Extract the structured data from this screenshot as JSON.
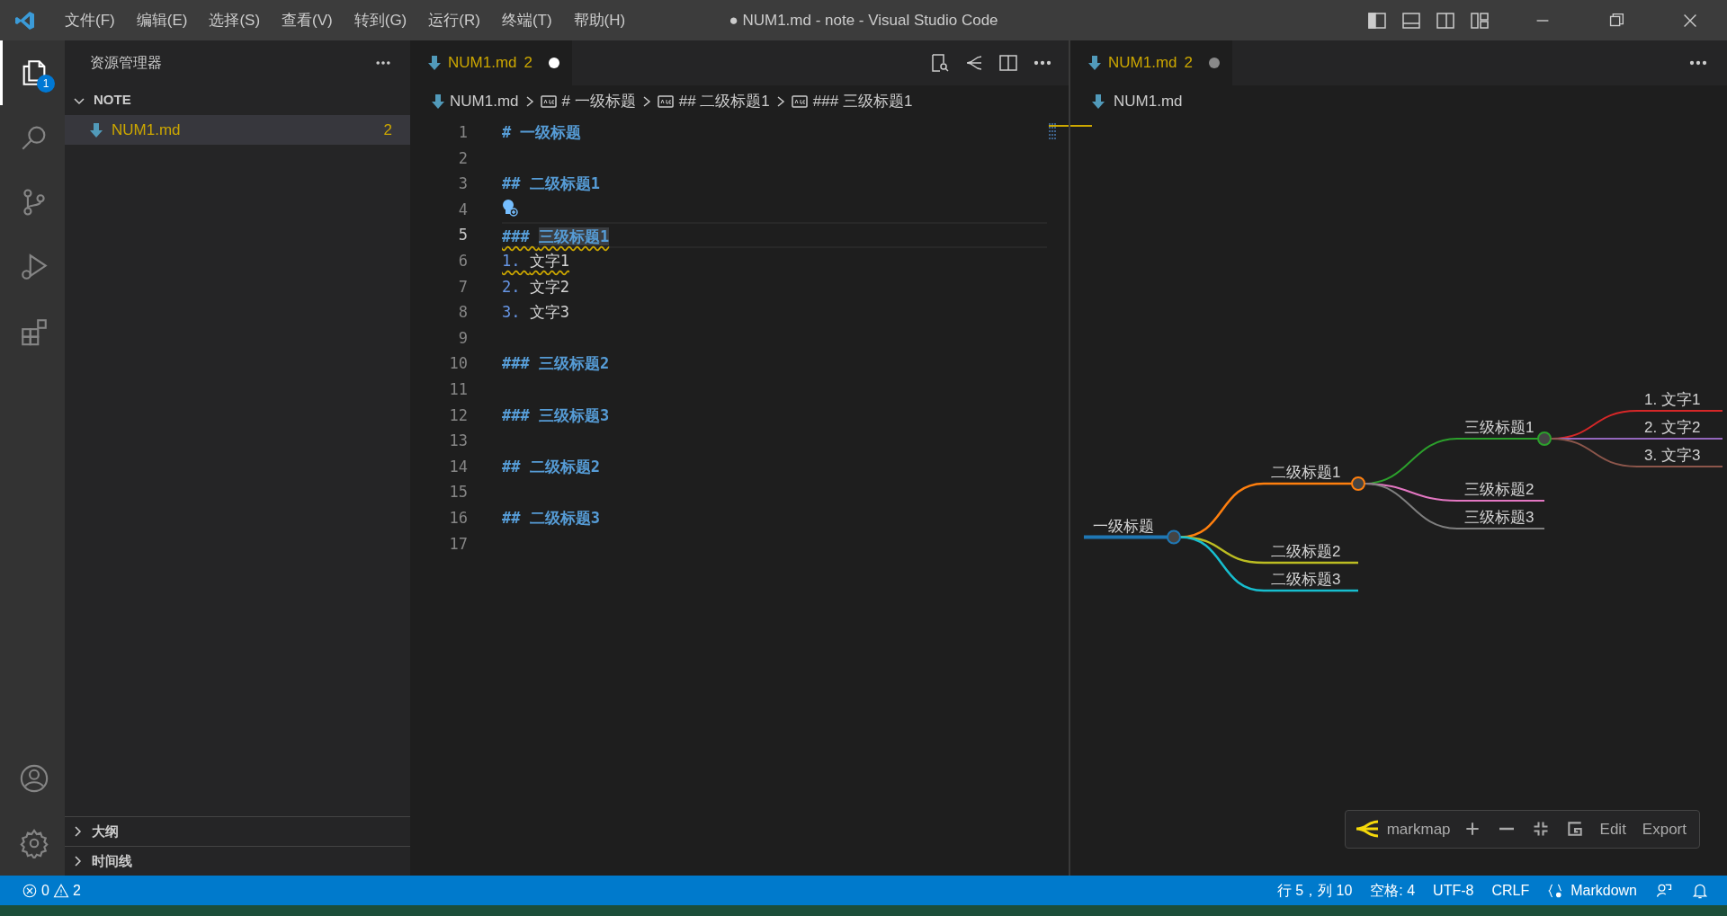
{
  "title_bar": {
    "menus": [
      "文件(F)",
      "编辑(E)",
      "选择(S)",
      "查看(V)",
      "转到(G)",
      "运行(R)",
      "终端(T)",
      "帮助(H)"
    ],
    "title": "● NUM1.md - note - Visual Studio Code"
  },
  "activity_bar": {
    "items": [
      {
        "kind": "explorer",
        "selected": true,
        "badge": "1"
      },
      {
        "kind": "search",
        "selected": false
      },
      {
        "kind": "scm",
        "selected": false
      },
      {
        "kind": "run",
        "selected": false
      },
      {
        "kind": "extensions",
        "selected": false
      }
    ]
  },
  "sidebar": {
    "title": "资源管理器",
    "folder": {
      "label": "NOTE",
      "expanded": true
    },
    "files": [
      {
        "name": "NUM1.md",
        "problems": "2",
        "selected": true
      }
    ],
    "panels": [
      {
        "label": "大纲",
        "expanded": false
      },
      {
        "label": "时间线",
        "expanded": false
      }
    ]
  },
  "editor": {
    "tabs": [
      {
        "label": "NUM1.md",
        "problems": "2",
        "dirty": true,
        "selected": true
      }
    ],
    "breadcrumbs": [
      {
        "kind": "file",
        "label": "NUM1.md"
      },
      {
        "kind": "symbol",
        "label": "# 一级标题"
      },
      {
        "kind": "symbol",
        "label": "## 二级标题1"
      },
      {
        "kind": "symbol",
        "label": "### 三级标题1"
      }
    ],
    "lines": [
      {
        "number": "1",
        "kind": "heading",
        "marker": "#",
        "text": "一级标题",
        "current": false,
        "warning": false
      },
      {
        "number": "2",
        "kind": "blank",
        "current": false
      },
      {
        "number": "3",
        "kind": "heading",
        "marker": "##",
        "text": "二级标题1",
        "current": false,
        "warning": false
      },
      {
        "number": "4",
        "kind": "lightbulb",
        "current": false
      },
      {
        "number": "5",
        "kind": "heading",
        "marker": "###",
        "text": "三级标题1",
        "current": true,
        "warning": true
      },
      {
        "number": "6",
        "kind": "list",
        "marker": "1.",
        "text": "文字1",
        "current": false,
        "warning": true
      },
      {
        "number": "7",
        "kind": "list",
        "marker": "2.",
        "text": "文字2",
        "current": false,
        "warning": false
      },
      {
        "number": "8",
        "kind": "list",
        "marker": "3.",
        "text": "文字3",
        "current": false,
        "warning": false
      },
      {
        "number": "9",
        "kind": "blank",
        "current": false
      },
      {
        "number": "10",
        "kind": "heading",
        "marker": "###",
        "text": "三级标题2",
        "current": false,
        "warning": false
      },
      {
        "number": "11",
        "kind": "blank",
        "current": false
      },
      {
        "number": "12",
        "kind": "heading",
        "marker": "###",
        "text": "三级标题3",
        "current": false,
        "warning": false
      },
      {
        "number": "13",
        "kind": "blank",
        "current": false
      },
      {
        "number": "14",
        "kind": "heading",
        "marker": "##",
        "text": "二级标题2",
        "current": false,
        "warning": false
      },
      {
        "number": "15",
        "kind": "blank",
        "current": false
      },
      {
        "number": "16",
        "kind": "heading",
        "marker": "##",
        "text": "二级标题3",
        "current": false,
        "warning": false
      },
      {
        "number": "17",
        "kind": "blank",
        "current": false
      }
    ]
  },
  "preview": {
    "tabs": [
      {
        "label": "NUM1.md",
        "problems": "2",
        "dirty": true,
        "selected": true
      }
    ],
    "breadcrumb": "NUM1.md",
    "mindmap": {
      "label": "一级标题",
      "color": "#1f77b4",
      "children": [
        {
          "label": "二级标题1",
          "color": "#ff7f0e",
          "children": [
            {
              "label": "三级标题1",
              "color": "#2ca02c",
              "children": [
                {
                  "label": "1. 文字1",
                  "color": "#d62728"
                },
                {
                  "label": "2. 文字2",
                  "color": "#9467bd"
                },
                {
                  "label": "3. 文字3",
                  "color": "#8c564b"
                }
              ]
            },
            {
              "label": "三级标题2",
              "color": "#e377c2"
            },
            {
              "label": "三级标题3",
              "color": "#7f7f7f"
            }
          ]
        },
        {
          "label": "二级标题2",
          "color": "#bcbd22"
        },
        {
          "label": "二级标题3",
          "color": "#17becf"
        }
      ]
    },
    "toolbar": {
      "brand": "markmap",
      "buttons": [
        {
          "kind": "zoom-in"
        },
        {
          "kind": "zoom-out"
        },
        {
          "kind": "fit"
        },
        {
          "kind": "toggle"
        },
        {
          "kind": "text",
          "label": "Edit"
        },
        {
          "kind": "text",
          "label": "Export"
        }
      ]
    }
  },
  "status_bar": {
    "errors": "0",
    "warnings": "2",
    "items": [
      "行 5，列 10",
      "空格: 4",
      "UTF-8",
      "CRLF"
    ],
    "language": "Markdown"
  }
}
